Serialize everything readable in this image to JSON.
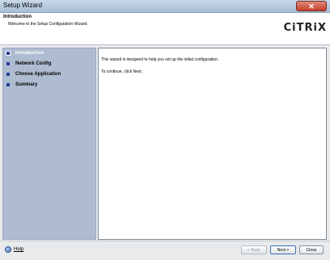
{
  "window": {
    "title": "Setup Wizard",
    "close_label": "✕"
  },
  "header": {
    "title": "Introduction",
    "subtitle": "Welcome to the Setup Configuration Wizard.",
    "logo_text": "CiTRiX",
    "logo_dot": "·"
  },
  "sidebar": {
    "items": [
      {
        "label": "Introduction",
        "active": true
      },
      {
        "label": "Network Config",
        "active": false
      },
      {
        "label": "Choose Application",
        "active": false
      },
      {
        "label": "Summary",
        "active": false
      }
    ]
  },
  "content": {
    "line1": "This wizard is designed to help you set up the initial configuration.",
    "line2": "To continue, click Next."
  },
  "footer": {
    "help_label": "Help",
    "back_label": "< Back",
    "next_label": "Next >",
    "close_label": "Close"
  },
  "colors": {
    "accent": "#1e3f99",
    "sidebar_bg": "#aebbd1",
    "logo_red": "#c8102e"
  }
}
